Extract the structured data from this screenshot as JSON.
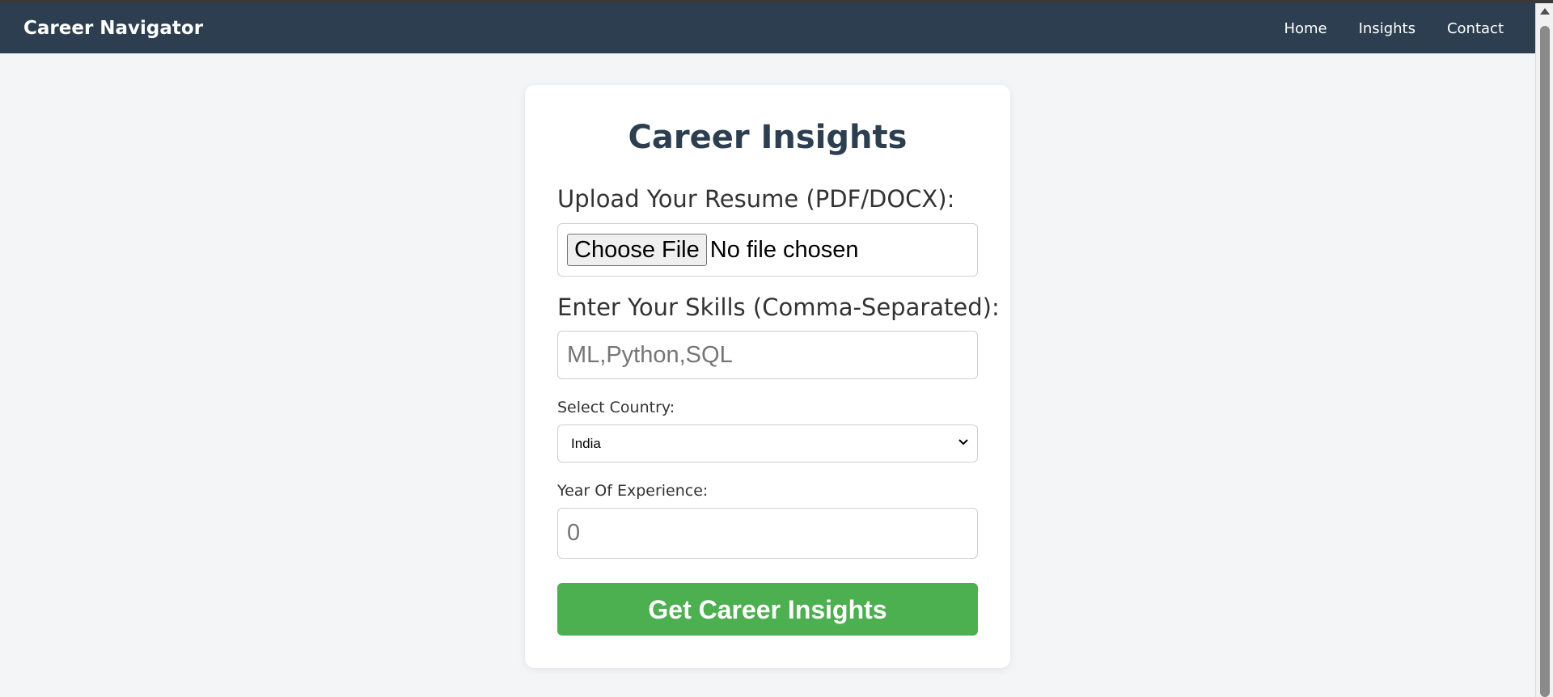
{
  "navbar": {
    "brand": "Career Navigator",
    "links": [
      "Home",
      "Insights",
      "Contact"
    ]
  },
  "form": {
    "title": "Career Insights",
    "resume_label": "Upload Your Resume (PDF/DOCX):",
    "file_button": "Choose File",
    "file_status": "No file chosen",
    "skills_label": "Enter Your Skills (Comma-Separated):",
    "skills_placeholder": "ML,Python,SQL",
    "skills_value": "",
    "country_label": "Select Country:",
    "country_value": "India",
    "experience_label": "Year Of Experience:",
    "experience_placeholder": "0",
    "experience_value": "",
    "submit_label": "Get Career Insights"
  },
  "colors": {
    "navbar_bg": "#2c3e50",
    "page_bg": "#f4f5f7",
    "title_color": "#2c3e50",
    "submit_bg": "#4caf50"
  },
  "icons": {
    "select_chevron": "chevron-down-icon",
    "scroll_up": "arrow-up-icon"
  }
}
